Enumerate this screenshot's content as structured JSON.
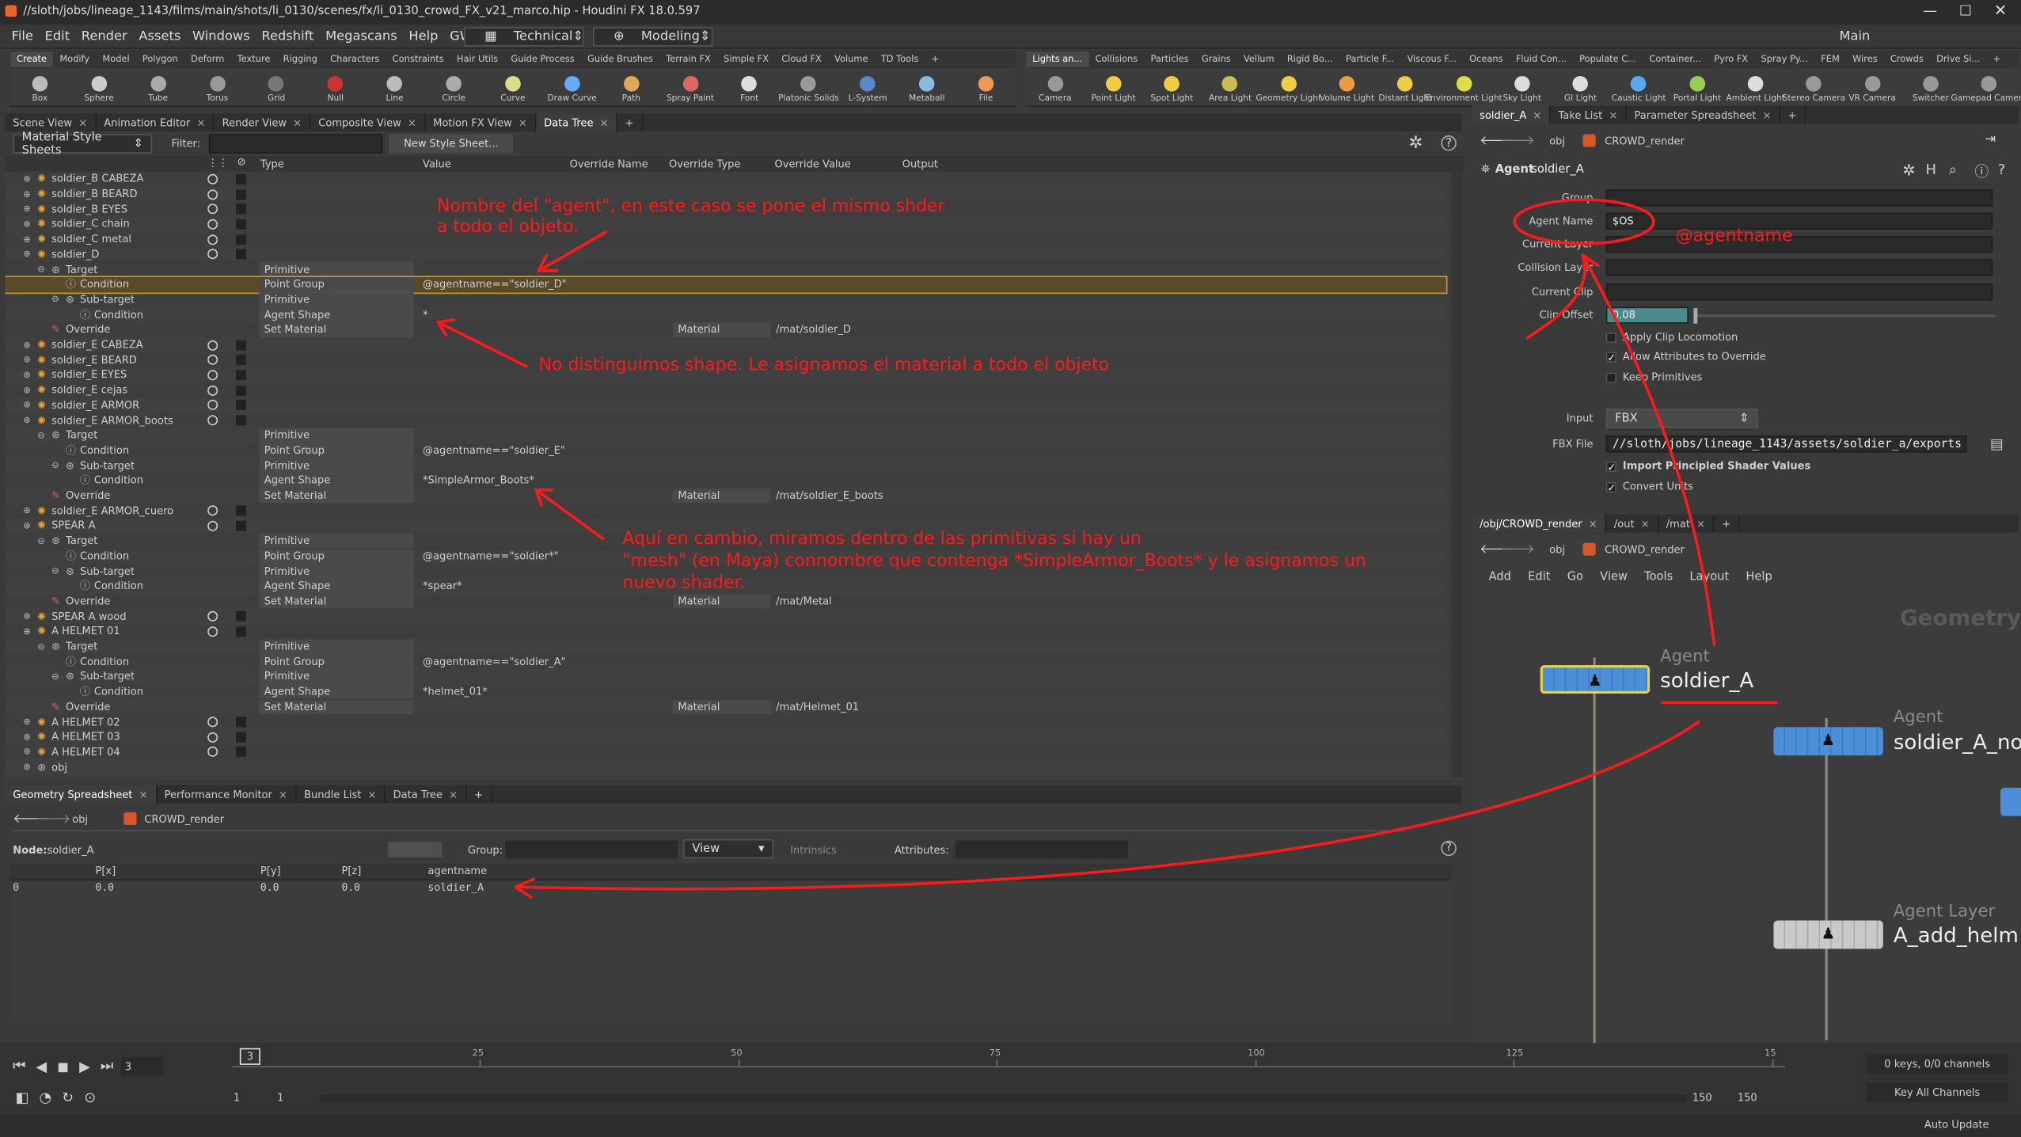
{
  "window": {
    "title": "//sloth/jobs/lineage_1143/films/main/shots/li_0130/scenes/fx/li_0130_crowd_FX_v21_marco.hip - Houdini FX 18.0.597"
  },
  "menu": [
    "File",
    "Edit",
    "Render",
    "Assets",
    "Windows",
    "Redshift",
    "Megascans",
    "Help",
    "GW Scripts"
  ],
  "desktop": {
    "value": "Technical",
    "mode": "Modeling",
    "main": "Main"
  },
  "shelf_left": {
    "tabs": [
      "Create",
      "Modify",
      "Model",
      "Polygon",
      "Deform",
      "Texture",
      "Rigging",
      "Characters",
      "Constraints",
      "Hair Utils",
      "Guide Process",
      "Guide Brushes",
      "Terrain FX",
      "Simple FX",
      "Cloud FX",
      "Volume",
      "TD Tools"
    ],
    "tools": [
      "Box",
      "Sphere",
      "Tube",
      "Torus",
      "Grid",
      "Null",
      "Line",
      "Circle",
      "Curve",
      "Draw Curve",
      "Path",
      "Spray Paint",
      "Font",
      "Platonic Solids",
      "L-System",
      "Metaball",
      "File"
    ]
  },
  "shelf_right": {
    "tabs": [
      "Lights an...",
      "Collisions",
      "Particles",
      "Grains",
      "Vellum",
      "Rigid Bo...",
      "Particle F...",
      "Viscous F...",
      "Oceans",
      "Fluid Con...",
      "Populate C...",
      "Container...",
      "Pyro FX",
      "Spray Py...",
      "FEM",
      "Wires",
      "Crowds",
      "Drive Si..."
    ],
    "tools": [
      "Camera",
      "Point Light",
      "Spot Light",
      "Area Light",
      "Geometry Light",
      "Volume Light",
      "Distant Light",
      "Environment Light",
      "Sky Light",
      "GI Light",
      "Caustic Light",
      "Portal Light",
      "Ambient Light",
      "Stereo Camera",
      "VR Camera",
      "Switcher",
      "Gamepad Camera"
    ]
  },
  "top_tabs": [
    "Scene View",
    "Animation Editor",
    "Render View",
    "Composite View",
    "Motion FX View",
    "Data Tree"
  ],
  "mss": {
    "selector": "Material Style Sheets",
    "filter_label": "Filter:",
    "new_btn": "New Style Sheet...",
    "headers": [
      "Type",
      "Value",
      "Override Name",
      "Override Type",
      "Override Value",
      "Output"
    ],
    "rows": [
      {
        "d": 0,
        "n": "soldier_B CABEZA"
      },
      {
        "d": 0,
        "n": "soldier_B BEARD"
      },
      {
        "d": 0,
        "n": "soldier_B EYES"
      },
      {
        "d": 0,
        "n": "soldier_C chain"
      },
      {
        "d": 0,
        "n": "soldier_C metal"
      },
      {
        "d": 0,
        "n": "soldier_D"
      },
      {
        "d": 1,
        "n": "Target",
        "t": "Primitive"
      },
      {
        "d": 2,
        "n": "Condition",
        "t": "Point Group",
        "v": "@agentname==\"soldier_D\"",
        "hl": 1
      },
      {
        "d": 2,
        "n": "Sub-target",
        "t": "Primitive"
      },
      {
        "d": 3,
        "n": "Condition",
        "t": "Agent Shape",
        "v": "*"
      },
      {
        "d": 1,
        "n": "Override",
        "t": "Set Material",
        "ot": "Material",
        "ov": "/mat/soldier_D"
      },
      {
        "d": 0,
        "n": "soldier_E CABEZA"
      },
      {
        "d": 0,
        "n": "soldier_E BEARD"
      },
      {
        "d": 0,
        "n": "soldier_E EYES"
      },
      {
        "d": 0,
        "n": "soldier_E cejas"
      },
      {
        "d": 0,
        "n": "soldier_E ARMOR"
      },
      {
        "d": 0,
        "n": "soldier_E ARMOR_boots"
      },
      {
        "d": 1,
        "n": "Target",
        "t": "Primitive"
      },
      {
        "d": 2,
        "n": "Condition",
        "t": "Point Group",
        "v": "@agentname==\"soldier_E\""
      },
      {
        "d": 2,
        "n": "Sub-target",
        "t": "Primitive"
      },
      {
        "d": 3,
        "n": "Condition",
        "t": "Agent Shape",
        "v": "*SimpleArmor_Boots*"
      },
      {
        "d": 1,
        "n": "Override",
        "t": "Set Material",
        "ot": "Material",
        "ov": "/mat/soldier_E_boots"
      },
      {
        "d": 0,
        "n": "soldier_E ARMOR_cuero"
      },
      {
        "d": 0,
        "n": "SPEAR A"
      },
      {
        "d": 1,
        "n": "Target",
        "t": "Primitive"
      },
      {
        "d": 2,
        "n": "Condition",
        "t": "Point Group",
        "v": "@agentname==\"soldier*\""
      },
      {
        "d": 2,
        "n": "Sub-target",
        "t": "Primitive"
      },
      {
        "d": 3,
        "n": "Condition",
        "t": "Agent Shape",
        "v": "*spear*"
      },
      {
        "d": 1,
        "n": "Override",
        "t": "Set Material",
        "ot": "Material",
        "ov": "/mat/Metal"
      },
      {
        "d": 0,
        "n": "SPEAR A wood"
      },
      {
        "d": 0,
        "n": "A HELMET 01"
      },
      {
        "d": 1,
        "n": "Target",
        "t": "Primitive"
      },
      {
        "d": 2,
        "n": "Condition",
        "t": "Point Group",
        "v": "@agentname==\"soldier_A\""
      },
      {
        "d": 2,
        "n": "Sub-target",
        "t": "Primitive"
      },
      {
        "d": 3,
        "n": "Condition",
        "t": "Agent Shape",
        "v": "*helmet_01*"
      },
      {
        "d": 1,
        "n": "Override",
        "t": "Set Material",
        "ot": "Material",
        "ov": "/mat/Helmet_01"
      },
      {
        "d": 0,
        "n": "A HELMET 02"
      },
      {
        "d": 0,
        "n": "A HELMET 03"
      },
      {
        "d": 0,
        "n": "A HELMET 04"
      },
      {
        "d": -1,
        "n": "obj"
      }
    ]
  },
  "annotations": {
    "a1": "Nombre del \"agent\", en este caso se pone el mismo shder",
    "a1b": "a todo el objeto.",
    "a2": "No distinguimos shape. Le asignamos el material a todo el objeto",
    "a3": "Aquí en cambio, miramos dentro de las primitivas si hay un",
    "a3b": "\"mesh\" (en Maya) connombre que contenga *SimpleArmor_Boots* y le asignamos un",
    "a3c": "nuevo shader.",
    "a4": "@agentname"
  },
  "bottom_tabs": [
    "Geometry Spreadsheet",
    "Performance Monitor",
    "Bundle List",
    "Data Tree"
  ],
  "spreadsheet": {
    "path_obj": "obj",
    "path_net": "CROWD_render",
    "node_label": "Node:",
    "node": "soldier_A",
    "group_label": "Group:",
    "view": "View",
    "intrinsics": "Intrinsics",
    "attributes_label": "Attributes:",
    "headers": [
      "P[x]",
      "P[y]",
      "P[z]",
      "agentname"
    ],
    "row": [
      "0",
      "0.0",
      "0.0",
      "0.0",
      "soldier_A"
    ]
  },
  "param": {
    "tabs": [
      "soldier_A",
      "Take List",
      "Parameter Spreadsheet"
    ],
    "path_obj": "obj",
    "path_net": "CROWD_render",
    "type": "Agent",
    "name": "soldier_A",
    "group_label": "Group",
    "agent_name_label": "Agent Name",
    "agent_name": "$OS",
    "cur_layer": "Current Layer",
    "coll_layer": "Collision Layer",
    "cur_clip": "Current Clip",
    "clip_offset_label": "Clip Offset",
    "clip_offset": "0.08",
    "apply_loco": "Apply Clip Locomotion",
    "allow_attr": "Allow Attributes to Override",
    "keep_prims": "Keep Primitives",
    "input_label": "Input",
    "input": "FBX",
    "fbx_label": "FBX File",
    "fbx": "//sloth/jobs/lineage_1143/assets/soldier_a/exports",
    "import_psv": "Import Principled Shader Values",
    "convert_units": "Convert Units"
  },
  "net": {
    "tabs": [
      "/obj/CROWD_render",
      "/out",
      "/mat"
    ],
    "path_obj": "obj",
    "path_net": "CROWD_render",
    "menu": [
      "Add",
      "Edit",
      "Go",
      "View",
      "Tools",
      "Layout",
      "Help"
    ],
    "watermark": "Geometry",
    "n1_type": "Agent",
    "n1_name": "soldier_A",
    "n2_type": "Agent",
    "n2_name": "soldier_A_no",
    "n3_type": "Agent Layer",
    "n3_name": "A_add_helm"
  },
  "timeline": {
    "frame": "3",
    "ticks": [
      "25",
      "50",
      "75",
      "100",
      "125",
      "15"
    ],
    "start1": "1",
    "start2": "1",
    "end1": "150",
    "end2": "150",
    "keys": "0 keys, 0/0 channels",
    "key_all": "Key All Channels",
    "auto_update": "Auto Update"
  }
}
